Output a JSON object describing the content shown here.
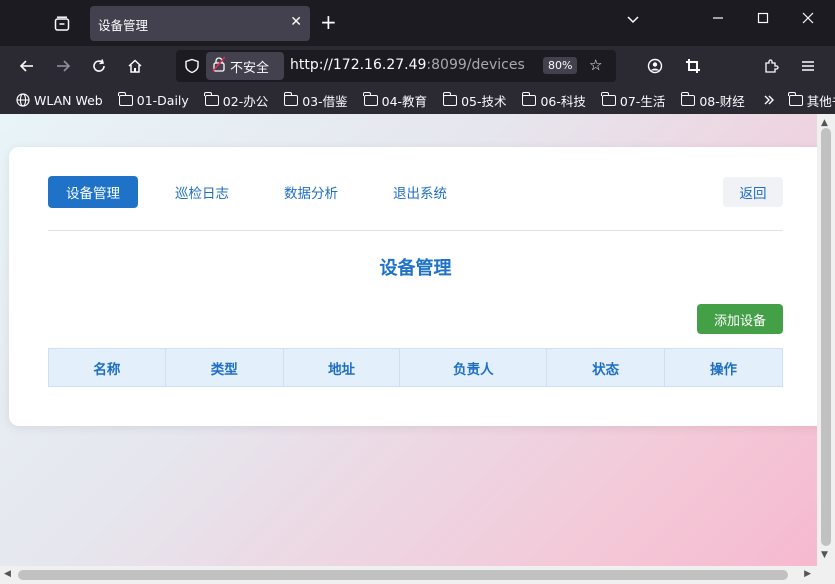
{
  "browser": {
    "tab_title": "设备管理",
    "url_insecure_label": "不安全",
    "url_host": "http://172.16.27.49",
    "url_rest": ":8099/devices",
    "zoom": "80%",
    "bookmarks": [
      {
        "label": "WLAN Web",
        "icon": "globe-icon"
      },
      {
        "label": "01-Daily",
        "icon": "folder-icon"
      },
      {
        "label": "02-办公",
        "icon": "folder-icon"
      },
      {
        "label": "03-借鉴",
        "icon": "folder-icon"
      },
      {
        "label": "04-教育",
        "icon": "folder-icon"
      },
      {
        "label": "05-技术",
        "icon": "folder-icon"
      },
      {
        "label": "06-科技",
        "icon": "folder-icon"
      },
      {
        "label": "07-生活",
        "icon": "folder-icon"
      },
      {
        "label": "08-财经",
        "icon": "folder-icon"
      }
    ],
    "other_bookmarks": "其他书签"
  },
  "app": {
    "menu": [
      "设备管理",
      "巡检日志",
      "数据分析",
      "退出系统"
    ],
    "active_menu": "设备管理",
    "back_label": "返回",
    "title": "设备管理",
    "add_button": "添加设备",
    "table_headers": [
      "名称",
      "类型",
      "地址",
      "负责人",
      "状态",
      "操作"
    ]
  }
}
